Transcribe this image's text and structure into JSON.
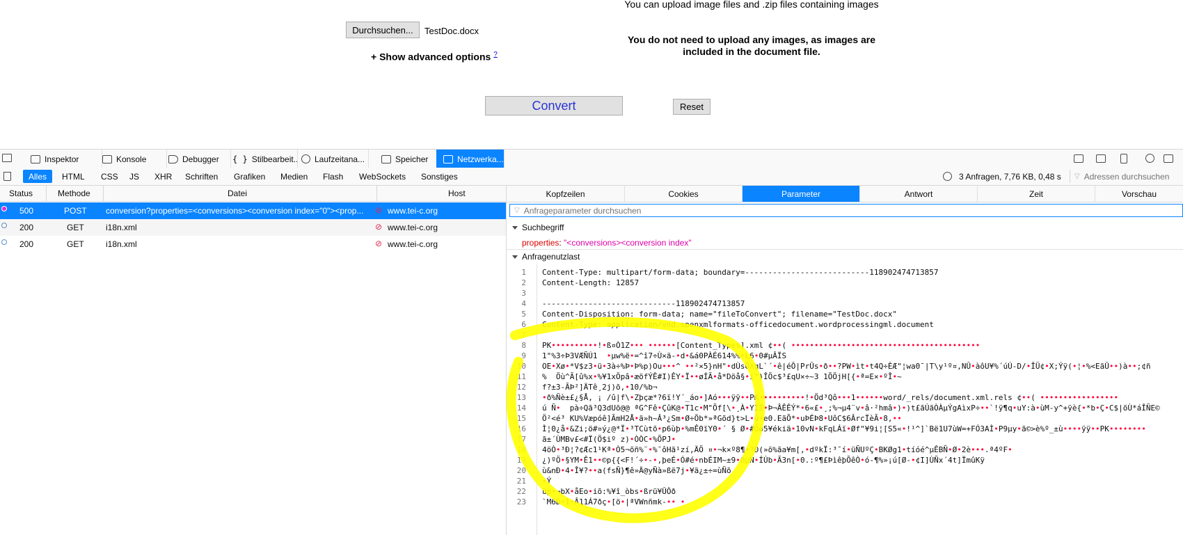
{
  "form": {
    "browse_button": "Durchsuchen...",
    "file_name": "TestDoc.docx",
    "upload_hint": "You can upload image files and .zip files containing images",
    "images_note": "You do not need to upload any images, as images are included in the document file.",
    "advanced_options": "+ Show advanced options",
    "advanced_help": "?",
    "convert_button": "Convert",
    "reset_button": "Reset"
  },
  "devtools": {
    "tabs": [
      "Inspektor",
      "Konsole",
      "Debugger",
      "Stilbearbeit...",
      "Laufzeitana...",
      "Speicher",
      "Netzwerka..."
    ],
    "active_tab": "Netzwerka...",
    "filters": [
      "Alles",
      "HTML",
      "CSS",
      "JS",
      "XHR",
      "Schriften",
      "Grafiken",
      "Medien",
      "Flash",
      "WebSockets",
      "Sonstiges"
    ],
    "active_filter": "Alles",
    "summary": "3 Anfragen, 7,76 KB, 0,48 s",
    "url_filter_placeholder": "Adressen durchsuchen",
    "columns": [
      "Status",
      "Methode",
      "Datei",
      "Host"
    ],
    "requests": [
      {
        "status": "500",
        "method": "POST",
        "file": "conversion?properties=<conversions><conversion index=\"0\"><prop...",
        "host": "www.tei-c.org",
        "selected": true,
        "dot_color": "#e22bdb"
      },
      {
        "status": "200",
        "method": "GET",
        "file": "i18n.xml",
        "host": "www.tei-c.org",
        "selected": false,
        "dot_color": "#5b8fc7"
      },
      {
        "status": "200",
        "method": "GET",
        "file": "i18n.xml",
        "host": "www.tei-c.org",
        "selected": false,
        "dot_color": "#5b8fc7"
      }
    ],
    "panel_tabs": [
      "Kopfzeilen",
      "Cookies",
      "Parameter",
      "Antwort",
      "Zeit",
      "Vorschau"
    ],
    "active_panel_tab": "Parameter",
    "param_filter_placeholder": "Anfrageparameter durchsuchen",
    "query_section": "Suchbegriff",
    "query_key": "properties",
    "query_value": "\"<conversions><conversion index\"",
    "payload_section": "Anfragenutzlast",
    "payload_lines": [
      "Content-Type: multipart/form-data; boundary=---------------------------118902474713857",
      "Content-Length: 12857",
      "",
      "-----------------------------118902474713857",
      "Content-Disposition: form-data; name=\"fileToConvert\"; filename=\"TestDoc.docx\"",
      "Content-Type: application/vnd.openxmlformats-officedocument.wordprocessingml.document",
      "",
      "PK••••••••••!•ß¤Ò1Z••• ••••••[Content_Types].xml ¢••( •••••••••••••••••••••••••••••••••••••••••",
      "1\"%3÷Þ3VÆÑÚ1  •µw%ë•=^î7÷Ù×ä-•d•&á0PÀÉ614%%•L6•0#µÂÏS",
      "OE•Xø•*V$z3•ü•3à÷%Þ•Þ%p)Ou•••^ ••²×5}nH\"•dÙsÓXgL`´•ê|éÔ|PrÛs•ð••?PW•ìt•t4Q÷ÈÆ\"¦wa0¯|T\\y¹º¤,NÛ•àôU¥%´úÚ-D/•ÎÜ¢•X;Ýÿ(•¦•%<EãÛ••)à••;¢ñ",
      "%  Öù^Ã[û%x•%¥1xÖpâ•æöfÝÊ#I)ÊY•Ï••øÍÃ•å*Döå§•i\")ÎÖc$³£qU×÷~3 1ÕÖjH[{•ª=E×•ºÎ•~",
      "f?±3-ÃÞ²]ÄTê¸2j)õ,•10/%b¬",
      "•ð%Ñè±£¿§Å, ¡ /û|f\\•Zþçæ*?6ï!Y´_áo•]Aó•••ÿÿ••PK••••••••••!•Öd³Qô•••1••••••word/_rels/document.xml.rels ¢••( •••••••••••••••••",
      "ú Ñ•  pà÷Qã³Q3dUõ@@ ªG^Fê•ÇûK@•T1c•M\"Õf[\\•¸À•YÎÌ•Þ¬ÂÊÊÝ*•6«£•¸;%¬µ4¨v•â·²hmâ•)•)t£ãÚãÒÀµÝgAìxP÷••`!ÿ¶q•uY:à•ùM-y^+ÿè{•*b•Ç•C$|õÙ*áÎÑE©",
      "Ö²<é³ KU%Væpóê]ÃmH2Å•ä»h~Â³¿Sm•Ø÷Öb*»ªGõd}t>L•ú•e0.EãÕ*•uÞÉÞ8•UôC$6ÂrcÏèÃ•8,••",
      "Ì¦0¿å•&Zi;ö#¤ý¿@*Ï•³TCùtõ•p6ùþ•%mÊ0ïY0•´ § Ø•#Õø5¥ékiä•10vN•kFqLÁï•Øf\"¥9i¦[S5«•!¹^]`Bë1U7ùW=+FÓ3AÌ•P9µy•ã©>è%º_±ù••••ÿÿ••PK••••••••",
      "ã±´ÙMBv£<#Ï(Ö$iº z)•ÒÒC•%ÕPJ•",
      "4öÒ•³Ð¦?¢Æc1¹Kª•Ò5¬õñ%¨•%¯ôHã¹zí,ÄÖ ¤•¬k×º8¶•³Ð(»ö%ãa¥m[,•dºkÏ:³¯í•üÑUºÇ•BKØg1•tíóé^µÊBÑ•Ø•2è•••.ª4ºF•",
      "¿)ºÖ•§YM•Ê1••©p{{<F!´÷•-•,þeÉ•Ó#é•nbÉIM~±9•0µN•ÍÚb•Ã3n[•0.:º¶£ÞìêþÕêÒ•ó-¶%»¡ú[Ø-•¢I]ÙÑx´4t]ÏmûKÿ",
      "ù&nÐ•4•Î¥?••a(fsÑ}¶ê»Ä@yÑà»ßë7j•¥ä¿±÷=ùÑõ",
      "•Ý",
      "üp•¬bX•åEo•iõ:%¥î_òbs•ßrü¥ÛÔð",
      "`M6Ð•1•Â11Á7ðç•[ö•|ªVWnñmk-•• •"
    ]
  },
  "colors": {
    "accent": "#0a84ff",
    "error_dot": "#e22bdb",
    "annotation": "#ffff00",
    "query_key": "#dd0000",
    "query_value": "#dd00a9"
  }
}
